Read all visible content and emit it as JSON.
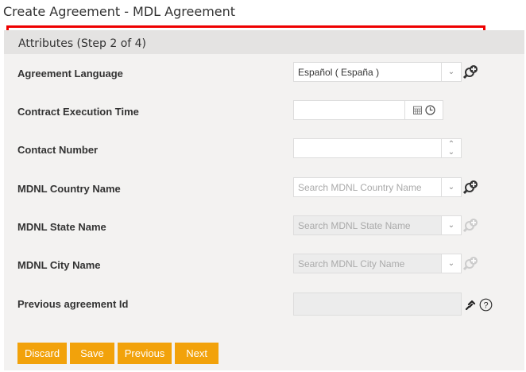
{
  "title": "Create Agreement - MDL Agreement",
  "section": "Attributes (Step 2 of 4)",
  "fields": [
    {
      "label": "Agreement Language",
      "value": "Español ( España )"
    },
    {
      "label": "Contract Execution Time",
      "value": ""
    },
    {
      "label": "Contact Number",
      "value": ""
    },
    {
      "label": "MDNL Country Name",
      "placeholder": "Search MDNL Country Name"
    },
    {
      "label": "MDNL State Name",
      "placeholder": "Search MDNL State Name"
    },
    {
      "label": "MDNL City Name",
      "placeholder": "Search MDNL City Name"
    },
    {
      "label": "Previous agreement Id",
      "value": ""
    }
  ],
  "buttons": {
    "discard": "Discard",
    "save": "Save",
    "previous": "Previous",
    "next": "Next"
  },
  "colors": {
    "accent": "#f2a20b",
    "highlight": "#e00000"
  }
}
